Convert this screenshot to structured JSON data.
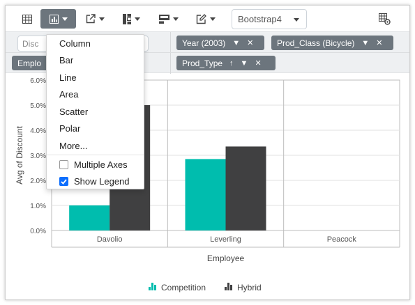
{
  "toolbar": {
    "buttons": [
      {
        "name": "grid-icon"
      },
      {
        "name": "chart-icon",
        "active": true
      },
      {
        "name": "export-icon"
      },
      {
        "name": "subtotals-icon"
      },
      {
        "name": "grandtotals-icon"
      },
      {
        "name": "format-icon"
      }
    ],
    "theme_select": "Bootstrap4",
    "settings_icon": "field-list-icon"
  },
  "grouping": {
    "filter_placeholder": "Disc",
    "row_field": "Emplo",
    "filters": [
      {
        "label": "Year (2003)"
      },
      {
        "label": "Prod_Class (Bicycle)"
      }
    ],
    "columns": [
      {
        "label": "Prod_Type"
      }
    ]
  },
  "chart_menu": {
    "items": [
      "Column",
      "Bar",
      "Line",
      "Area",
      "Scatter",
      "Polar",
      "More..."
    ],
    "checkboxes": [
      {
        "label": "Multiple Axes",
        "checked": false
      },
      {
        "label": "Show Legend",
        "checked": true
      }
    ]
  },
  "chart_data": {
    "type": "bar",
    "categories": [
      "Davolio",
      "Leverling",
      "Peacock"
    ],
    "series": [
      {
        "name": "Competition",
        "values": [
          0.01,
          0.0285,
          null
        ],
        "color": "#00bdae"
      },
      {
        "name": "Hybrid",
        "values": [
          0.05,
          0.0335,
          null
        ],
        "color": "#404041"
      }
    ],
    "xlabel": "Employee",
    "ylabel": "Avg of Discount",
    "ylim": [
      0,
      0.06
    ],
    "yticks": [
      "0.0%",
      "1.0%",
      "2.0%",
      "3.0%",
      "4.0%",
      "5.0%",
      "6.0%"
    ],
    "grid": true,
    "legend_position": "bottom"
  }
}
